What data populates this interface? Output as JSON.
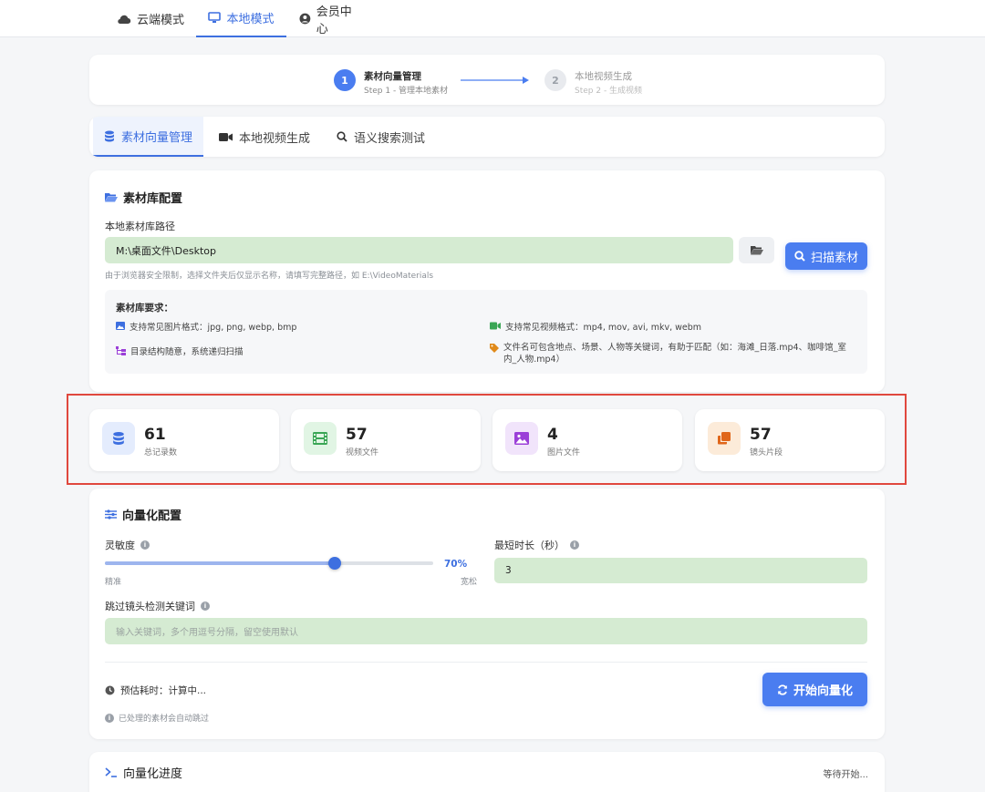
{
  "top_nav": {
    "tabs": [
      {
        "label": "云端模式",
        "icon": "cloud-icon"
      },
      {
        "label": "本地模式",
        "icon": "monitor-icon"
      },
      {
        "label": "会员中心",
        "icon": "user-circle-icon"
      }
    ],
    "active": 1
  },
  "steps": [
    {
      "number": "1",
      "title": "素材向量管理",
      "subtitle": "Step 1 - 管理本地素材"
    },
    {
      "number": "2",
      "title": "本地视频生成",
      "subtitle": "Step 2 - 生成视频"
    }
  ],
  "sub_tabs": [
    {
      "label": "素材向量管理",
      "icon": "database-icon"
    },
    {
      "label": "本地视频生成",
      "icon": "video-camera-icon"
    },
    {
      "label": "语义搜索测试",
      "icon": "search-icon"
    }
  ],
  "library": {
    "title": "素材库配置",
    "path_label": "本地素材库路径",
    "path_value": "M:\\桌面文件\\Desktop",
    "scan_label": "扫描素材",
    "hint": "由于浏览器安全限制，选择文件夹后仅显示名称，请填写完整路径，如 E:\\VideoMaterials",
    "requirements_title": "素材库要求：",
    "requirements": [
      "支持常见图片格式：jpg, png, webp, bmp",
      "支持常见视频格式：mp4, mov, avi, mkv, webm",
      "目录结构随意，系统递归扫描",
      "文件名可包含地点、场景、人物等关键词，有助于匹配（如：海滩_日落.mp4、咖啡馆_室内_人物.mp4）"
    ]
  },
  "stats": [
    {
      "value": "61",
      "label": "总记录数",
      "icon": "database-icon",
      "color": "#3d6fe0",
      "bg": "#e4ecfd"
    },
    {
      "value": "57",
      "label": "视频文件",
      "icon": "film-icon",
      "color": "#3aa655",
      "bg": "#e1f5e4"
    },
    {
      "value": "4",
      "label": "图片文件",
      "icon": "image-icon",
      "color": "#9b3fd8",
      "bg": "#f1e4fb"
    },
    {
      "value": "57",
      "label": "镜头片段",
      "icon": "clone-icon",
      "color": "#e0661a",
      "bg": "#fcebd9"
    }
  ],
  "vector": {
    "title": "向量化配置",
    "sensitivity_label": "灵敏度",
    "sensitivity_value": "70%",
    "sensitivity_level": 0.7,
    "slider_min_label": "精准",
    "slider_max_label": "宽松",
    "min_duration_label": "最短时长（秒）",
    "min_duration_value": "3",
    "skip_keywords_label": "跳过镜头检测关键词",
    "skip_keywords_placeholder": "输入关键词，多个用逗号分隔，留空使用默认",
    "estimate": "预估耗时：计算中...",
    "skip_note": "已处理的素材会自动跳过",
    "start_label": "开始向量化"
  },
  "progress": {
    "title": "向量化进度",
    "status": "等待开始..."
  },
  "colors": {
    "accent": "#4a7df0",
    "highlight": "#e0483e",
    "field_bg": "#d5ebd2"
  }
}
